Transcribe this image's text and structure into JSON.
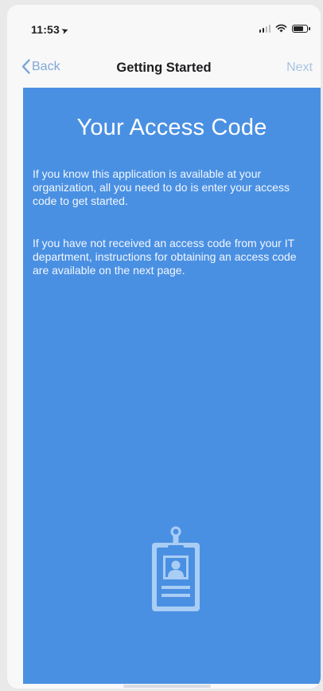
{
  "status_bar": {
    "time": "11:53",
    "location_glyph": "➤",
    "icons": [
      "signal-icon",
      "wifi-icon",
      "battery-icon"
    ]
  },
  "nav": {
    "back_label": "Back",
    "title": "Getting Started",
    "next_label": "Next"
  },
  "main": {
    "heading": "Your Access Code",
    "paragraph_1": "If you know this application is available at your organization, all you need to do is enter your access code to get started.",
    "paragraph_2": "If you have not received an access code from your IT department, instructions for obtaining an access code are available on the next page.",
    "illustration": "id-badge-icon"
  },
  "colors": {
    "accent": "#4a90e2",
    "nav_link": "#7fa7d6",
    "nav_link_disabled": "#a9c3e2",
    "background": "#f8f8f9"
  }
}
